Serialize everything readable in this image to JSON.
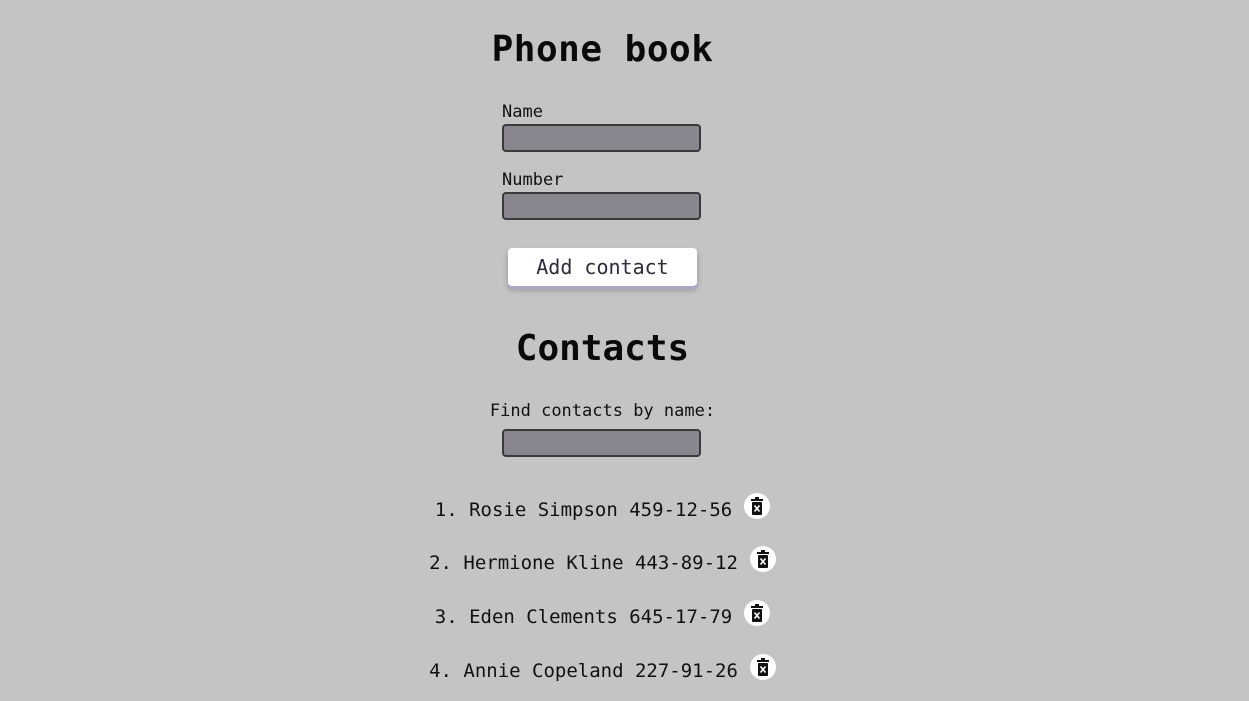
{
  "app": {
    "title": "Phone book"
  },
  "form": {
    "name_label": "Name",
    "name_value": "",
    "number_label": "Number",
    "number_value": "",
    "add_label": "Add contact"
  },
  "contacts": {
    "title": "Contacts",
    "filter_label": "Find contacts by name:",
    "filter_value": "",
    "items": [
      {
        "text": "1. Rosie Simpson 459-12-56"
      },
      {
        "text": "2. Hermione Kline 443-89-12"
      },
      {
        "text": "3. Eden Clements 645-17-79"
      },
      {
        "text": "4. Annie Copeland 227-91-26"
      }
    ]
  },
  "icons": {
    "delete": "trash-icon"
  },
  "colors": {
    "background": "#c4c4c4",
    "input_fill": "#8a8690",
    "button_fill": "#ffffff"
  }
}
